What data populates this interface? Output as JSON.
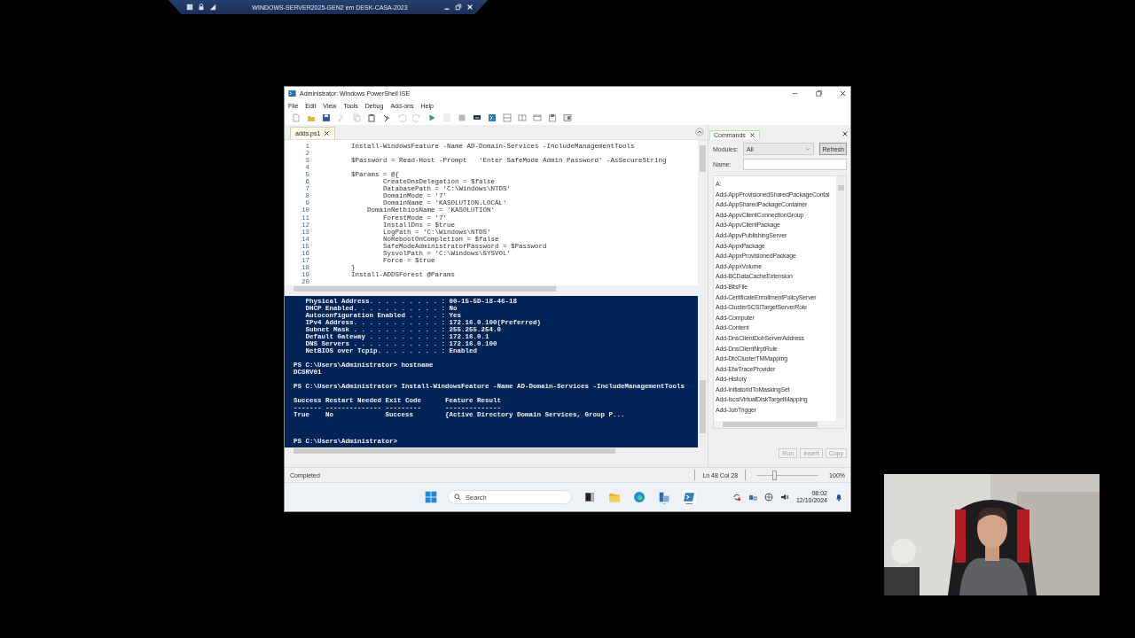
{
  "vm_bar": {
    "title": "WINDOWS-SERVER2025-GEN2 em DESK-CASA-2023"
  },
  "window": {
    "title": "Administrator: Windows PowerShell ISE"
  },
  "menu": [
    "File",
    "Edit",
    "View",
    "Tools",
    "Debug",
    "Add-ons",
    "Help"
  ],
  "toolbar": [
    {
      "kind": "new",
      "disabled": false
    },
    {
      "kind": "open",
      "disabled": false
    },
    {
      "kind": "save",
      "disabled": false
    },
    {
      "kind": "cut",
      "disabled": true
    },
    {
      "kind": "copy",
      "disabled": true
    },
    {
      "kind": "paste",
      "disabled": false
    },
    {
      "kind": "clear",
      "disabled": false
    },
    {
      "kind": "undo",
      "disabled": true
    },
    {
      "kind": "redo",
      "disabled": true
    },
    {
      "kind": "run",
      "disabled": false
    },
    {
      "kind": "run-selection",
      "disabled": true
    },
    {
      "kind": "stop",
      "disabled": true
    },
    {
      "kind": "remote",
      "disabled": false
    },
    {
      "kind": "powershell",
      "disabled": false
    },
    {
      "kind": "pane-top",
      "disabled": false
    },
    {
      "kind": "pane-right",
      "disabled": false
    },
    {
      "kind": "pane-max",
      "disabled": false
    },
    {
      "kind": "script",
      "disabled": false
    },
    {
      "kind": "commands",
      "disabled": false
    }
  ],
  "editor_tabs": [
    {
      "label": "adds.ps1",
      "selected": true
    }
  ],
  "code_lines": [
    {
      "n": "1",
      "text": "Install-WindowsFeature -Name AD-Domain-Services -IncludeManagementTools"
    },
    {
      "n": "2"
    },
    {
      "n": "3",
      "text": "$Password = Read-Host -Prompt   'Enter SafeMode Admin Password' -AsSecureString"
    },
    {
      "n": "4"
    },
    {
      "n": "5",
      "text": "$Params = @{"
    },
    {
      "n": "6",
      "text": "        CreateDnsDelegation = $false"
    },
    {
      "n": "7",
      "text": "        DatabasePath = 'C:\\Windows\\NTDS'"
    },
    {
      "n": "8",
      "text": "        DomainMode = '7'"
    },
    {
      "n": "9",
      "text": "        DomainName = 'KASOLUTION.LOCAL'"
    },
    {
      "n": "10",
      "text": "    DomainNetbiosName = 'KASOLUTION'"
    },
    {
      "n": "11",
      "text": "        ForestMode = '7'"
    },
    {
      "n": "12",
      "text": "        InstallDns = $true"
    },
    {
      "n": "13",
      "text": "        LogPath = 'C:\\Windows\\NTDS'"
    },
    {
      "n": "14",
      "text": "        NoRebootOnCompletion = $false"
    },
    {
      "n": "15",
      "text": "        SafeModeAdministratorPassword = $Password"
    },
    {
      "n": "16",
      "text": "        SysvolPath = 'C:\\Windows\\SYSVOL'"
    },
    {
      "n": "17",
      "text": "        Force = $true"
    },
    {
      "n": "18",
      "text": "}"
    },
    {
      "n": "19",
      "text": "Install-ADDSForest @Params"
    },
    {
      "n": "20"
    }
  ],
  "console_blocks": [
    [
      "   Physical Address. . . . . . . . . : 00-15-5D-18-46-18",
      "   DHCP Enabled. . . . . . . . . . . : No",
      "   Autoconfiguration Enabled . . . . : Yes",
      "   IPv4 Address. . . . . . . . . . . : 172.16.0.100(Preferred)",
      "   Subnet Mask . . . . . . . . . . . : 255.255.254.0",
      "   Default Gateway . . . . . . . . . : 172.16.0.1",
      "   DNS Servers . . . . . . . . . . . : 172.16.0.100",
      "   NetBIOS over Tcpip. . . . . . . . : Enabled"
    ],
    [
      "PS C:\\Users\\Administrator> hostname",
      "DCSRV01"
    ],
    [
      "PS C:\\Users\\Administrator> Install-WindowsFeature -Name AD-Domain-Services -IncludeManagementTools"
    ],
    [
      "Success Restart Needed Exit Code      Feature Result",
      "------- -------------- ---------      --------------",
      "True    No             Success        {Active Directory Domain Services, Group P..."
    ],
    [
      "PS C:\\Users\\Administrator>"
    ]
  ],
  "commands": {
    "tab": "Commands",
    "modules_label": "Modules:",
    "modules_value": "All",
    "refresh": "Refresh",
    "name_label": "Name:",
    "items": [
      "A:",
      "Add-AppProvisionedSharedPackageContai",
      "Add-AppSharedPackageContainer",
      "Add-AppvClientConnectionGroup",
      "Add-AppvClientPackage",
      "Add-AppvPublishingServer",
      "Add-AppxPackage",
      "Add-AppxProvisionedPackage",
      "Add-AppxVolume",
      "Add-BCDataCacheExtension",
      "Add-BitsFile",
      "Add-CertificateEnrollmentPolicyServer",
      "Add-ClusterSCSITargetServerRole",
      "Add-Computer",
      "Add-Content",
      "Add-DnsClientDohServerAddress",
      "Add-DnsClientNrptRule",
      "Add-DtcClusterTMMapping",
      "Add-EtwTraceProvider",
      "Add-History",
      "Add-InitiatorIdToMaskingSet",
      "Add-IscsiVirtualDiskTargetMapping",
      "Add-JobTrigger"
    ],
    "buttons": [
      "Run",
      "Insert",
      "Copy"
    ]
  },
  "status_bar": {
    "status": "Completed",
    "position": "Ln 48  Col 28",
    "zoom": {
      "level": 0.25
    },
    "zoom_text": "100%"
  },
  "taskbar": {
    "search_placeholder": "Search",
    "apps": [
      {
        "kind": "taskview",
        "selected": false,
        "running": false
      },
      {
        "kind": "explorer",
        "selected": false,
        "running": false
      },
      {
        "kind": "browser",
        "selected": false,
        "running": false
      },
      {
        "kind": "server-manager",
        "selected": false,
        "running": true
      },
      {
        "kind": "powershell",
        "selected": true,
        "running": true
      }
    ],
    "time": "08:02",
    "date": "12/10/2024"
  },
  "webcam": {
    "kind": "picture"
  }
}
